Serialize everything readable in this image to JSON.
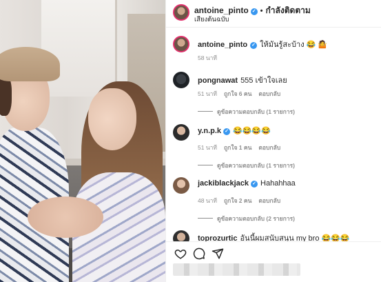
{
  "header": {
    "username": "antoine_pinto",
    "separator": "•",
    "follow_label": "กำลังติดตาม",
    "subtitle": "เสียงต้นฉบับ"
  },
  "caption": {
    "username": "antoine_pinto",
    "text": "ให้มันรู้สะบ้าง 😂 🤷",
    "time": "58 นาที"
  },
  "comments": [
    {
      "username": "pongnawat",
      "text": "555 เข้าใจเลย",
      "time": "51 นาที",
      "likes": "ถูกใจ 6 คน",
      "reply_label": "ตอบกลับ",
      "replies": "ดูข้อความตอบกลับ (1 รายการ)"
    },
    {
      "username": "y.n.p.k",
      "verified": true,
      "text": "😂😂😂😂",
      "time": "51 นาที",
      "likes": "ถูกใจ 1 คน",
      "reply_label": "ตอบกลับ",
      "replies": "ดูข้อความตอบกลับ (1 รายการ)"
    },
    {
      "username": "jackiblackjack",
      "verified": true,
      "text": "Hahahhaa",
      "time": "48 นาที",
      "likes": "ถูกใจ 2 คน",
      "reply_label": "ตอบกลับ",
      "replies": "ดูข้อความตอบกลับ (2 รายการ)"
    },
    {
      "username": "toprozurtic",
      "text": "อันนี้ผมสนับสนุน my bro 😂😂😂"
    }
  ],
  "icons": {
    "like": "heart-icon",
    "comment": "comment-icon",
    "share": "send-icon"
  },
  "colors": {
    "verified": "#3897f0",
    "story_ring": "#e1306c",
    "meta_text": "#8e8e8e"
  }
}
